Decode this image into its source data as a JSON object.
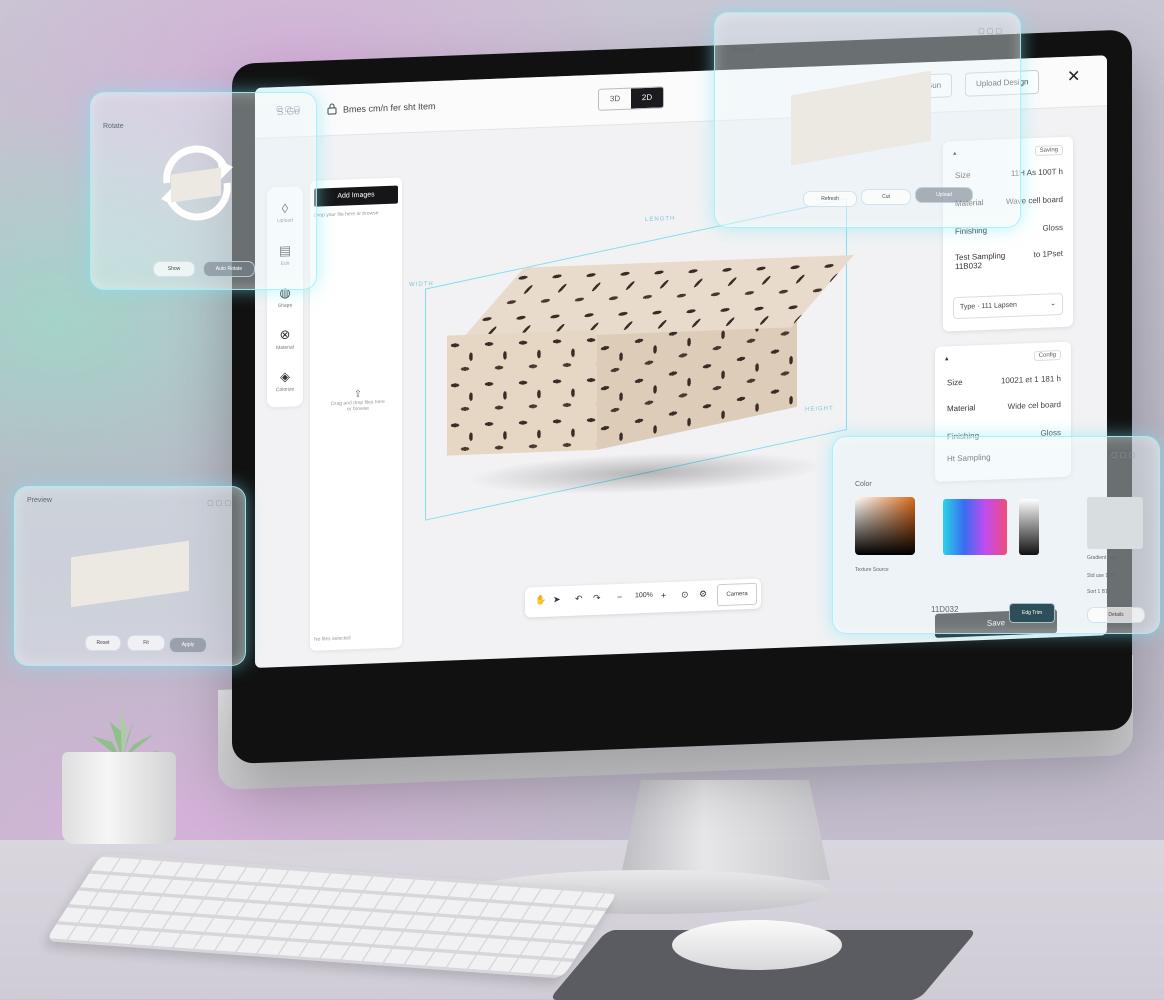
{
  "app": {
    "logo": "S.Go",
    "document_title": "Bmes cm/n fer sht Item",
    "view_toggle": [
      "3D",
      "2D"
    ],
    "header_buttons": [
      "Gun",
      "Upload Design"
    ]
  },
  "left_rail": [
    {
      "icon": "drop-icon",
      "label": "Upload"
    },
    {
      "icon": "layers-icon",
      "label": "Edit"
    },
    {
      "icon": "shape-icon",
      "label": "Shape"
    },
    {
      "icon": "material-icon",
      "label": "Material"
    },
    {
      "icon": "fill-icon",
      "label": "Colorize"
    }
  ],
  "left_panel": {
    "primary_button": "Add Images",
    "subtitle": "Drop your file here or browse",
    "upload_hint": "Drag and drop files here or browse",
    "footer": "No files selected"
  },
  "viewport": {
    "dim_top": "LENGTH",
    "dim_left": "WIDTH",
    "dim_right": "HEIGHT"
  },
  "toolbar": {
    "zoom": "100%",
    "button": "Camera"
  },
  "panel_dimensions": {
    "chip": "Saving",
    "rows": [
      {
        "label": "Size",
        "value": "11H As 100T h"
      },
      {
        "label": "Material",
        "value": "Wave cell board"
      },
      {
        "label": "Finishing",
        "value": "Gloss"
      },
      {
        "label": "Test Sampling 11B032",
        "value": "to 1Pset"
      }
    ],
    "select": "Type · 111 Lapsen"
  },
  "panel_material": {
    "chip": "Config",
    "rows": [
      {
        "label": "Size",
        "value": "10021 et 1 181 h"
      },
      {
        "label": "Material",
        "value": "Wide cel board"
      },
      {
        "label": "Finishing",
        "value": "Gloss"
      },
      {
        "label": "Ht Sampling",
        "value": ""
      }
    ]
  },
  "save_button": "Save",
  "glass_rotate": {
    "title": "Rotate",
    "buttons": [
      "Show",
      "Auto Rotate"
    ]
  },
  "glass_preview": {
    "title": "Preview",
    "buttons": [
      "Reset",
      "Fit",
      "Apply"
    ]
  },
  "glass_top": {
    "title": "Texture",
    "buttons": [
      "Refresh",
      "Cut",
      "Upload"
    ]
  },
  "glass_color": {
    "title": "Color",
    "hint": "Texture Source",
    "field": "11D032",
    "apply": "Edg Trim",
    "right_labels": [
      "Gradient type",
      "Std use 1 R1",
      "Sort 1 B1",
      "Details"
    ]
  },
  "colors": {
    "accent_glow": "#8fe8f5",
    "dark": "#17171a",
    "box_kraft": "#e5d7c4"
  }
}
